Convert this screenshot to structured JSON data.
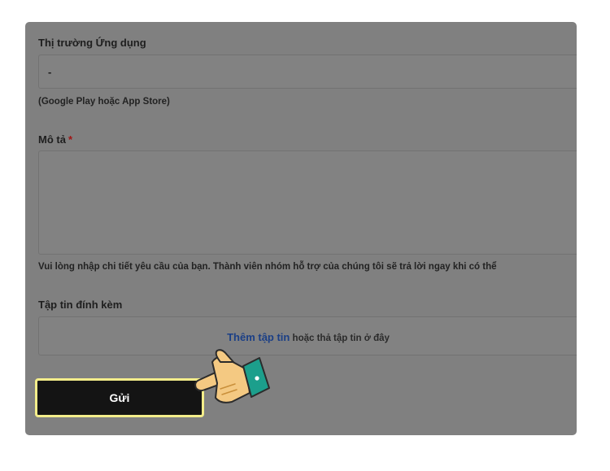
{
  "app_market": {
    "label": "Thị trường Ứng dụng",
    "value": "-",
    "hint": "(Google Play hoặc App Store)"
  },
  "description": {
    "label": "Mô tả",
    "required_mark": "*",
    "value": "",
    "hint": "Vui lòng nhập chi tiết yêu cầu của bạn. Thành viên nhóm hỗ trợ của chúng tôi sẽ trả lời ngay khi có thể"
  },
  "attachments": {
    "label": "Tập tin đính kèm",
    "add_link": "Thêm tập tin",
    "drop_text": " hoặc thả tập tin ở đây"
  },
  "submit": {
    "label": "Gửi"
  },
  "colors": {
    "overlay": "#808080",
    "button_bg": "#141414",
    "button_highlight": "#f3ed8a",
    "link": "#1b3f86",
    "required": "#a01414",
    "hand_skin": "#f4c982",
    "hand_cuff": "#1c9f8c"
  },
  "icons": {
    "pointer": "pointing-hand-icon"
  }
}
